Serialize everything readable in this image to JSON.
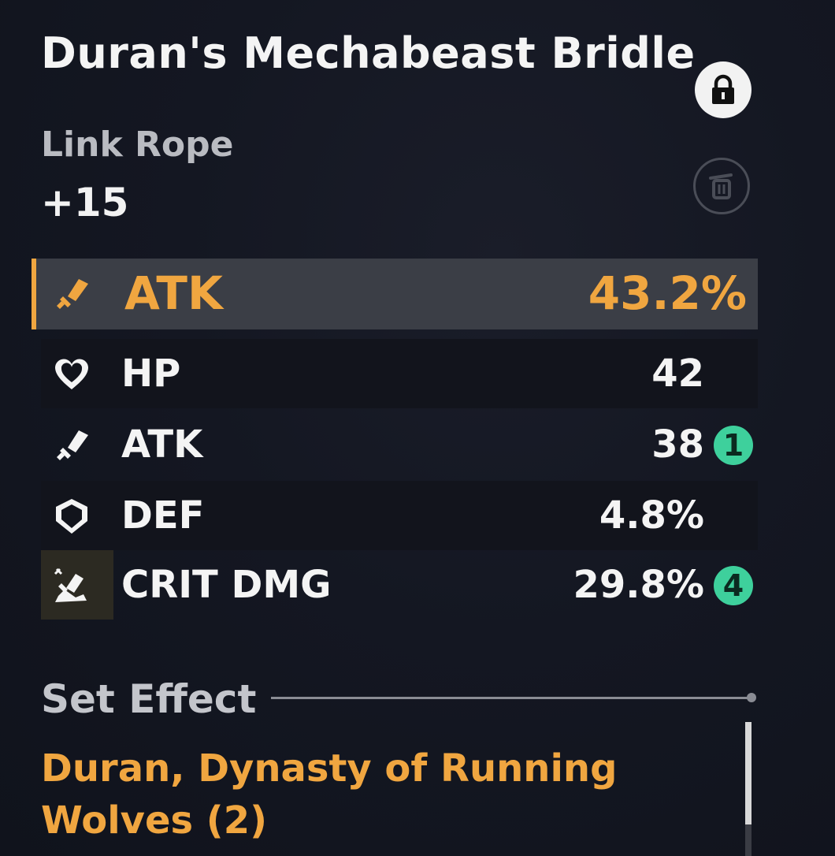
{
  "item": {
    "name": "Duran's Mechabeast Bridle",
    "type": "Link Rope",
    "level": "+15"
  },
  "main_stat": {
    "name": "ATK",
    "value": "43.2%",
    "icon": "sword-icon"
  },
  "sub_stats": [
    {
      "name": "HP",
      "value": "42",
      "icon": "heart-icon",
      "badge": null
    },
    {
      "name": "ATK",
      "value": "38",
      "icon": "sword-icon",
      "badge": "1"
    },
    {
      "name": "DEF",
      "value": "4.8%",
      "icon": "shield-icon",
      "badge": null
    },
    {
      "name": "CRIT DMG",
      "value": "29.8%",
      "icon": "crit-dmg-icon",
      "badge": "4"
    }
  ],
  "set_effect": {
    "label": "Set Effect",
    "name": "Duran, Dynasty of Running Wolves (2)"
  },
  "colors": {
    "accent": "#f0a640",
    "badge": "#3ed09c",
    "highlight_row": "#3b3e46"
  },
  "buttons": {
    "lock": "lock-icon",
    "discard": "trash-icon"
  }
}
